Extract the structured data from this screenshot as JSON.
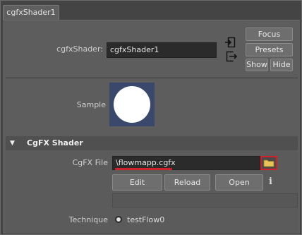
{
  "tab": {
    "title": "cgfxShader1"
  },
  "shader": {
    "label": "cgfxShader:",
    "value": "cgfxShader1"
  },
  "buttons": {
    "focus": "Focus",
    "presets": "Presets",
    "show": "Show",
    "hide": "Hide"
  },
  "sample": {
    "label": "Sample"
  },
  "section": {
    "title": "CgFX Shader"
  },
  "cgfx_file": {
    "label": "CgFX File",
    "value": "\\flowmapp.cgfx"
  },
  "file_buttons": {
    "edit": "Edit",
    "reload": "Reload",
    "open": "Open",
    "info": "i"
  },
  "technique": {
    "label": "Technique",
    "option": "testFlow0"
  },
  "colors": {
    "highlight": "#d0202a",
    "swatch_bg": "#39486b",
    "field_bg": "#2b2b2b"
  }
}
